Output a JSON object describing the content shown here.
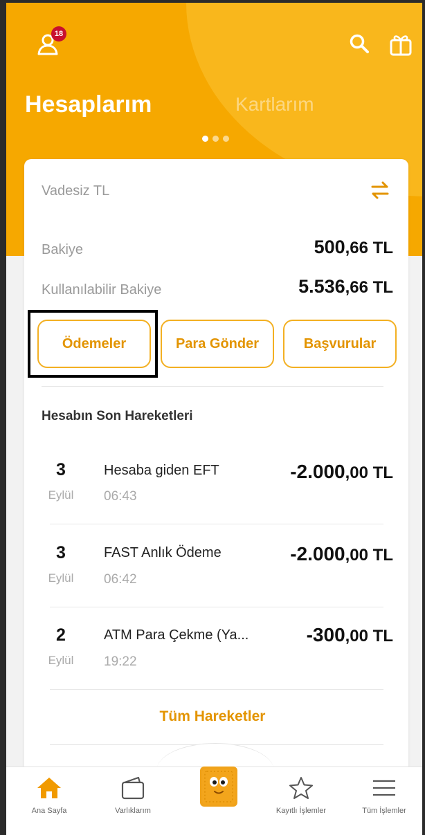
{
  "header": {
    "notification_count": "18",
    "tabs": [
      {
        "label": "Hesaplarım",
        "active": true
      },
      {
        "label": "Kartlarım",
        "active": false
      }
    ]
  },
  "account": {
    "name": "Vadesiz TL",
    "balance_label": "Bakiye",
    "balance_int": "500",
    "balance_dec": ",66 TL",
    "available_label": "Kullanılabilir Bakiye",
    "available_int": "5.536",
    "available_dec": ",66 TL"
  },
  "actions": {
    "payments": "Ödemeler",
    "send_money": "Para Gönder",
    "applications": "Başvurular"
  },
  "transactions": {
    "title": "Hesabın Son Hareketleri",
    "items": [
      {
        "day": "3",
        "month": "Eylül",
        "desc": "Hesaba giden EFT",
        "time": "06:43",
        "amount_int": "-2.000",
        "amount_dec": ",00 TL"
      },
      {
        "day": "3",
        "month": "Eylül",
        "desc": "FAST Anlık Ödeme",
        "time": "06:42",
        "amount_int": "-2.000",
        "amount_dec": ",00 TL"
      },
      {
        "day": "2",
        "month": "Eylül",
        "desc": "ATM Para Çekme (Ya...",
        "time": "19:22",
        "amount_int": "-300",
        "amount_dec": ",00 TL"
      }
    ],
    "all_link": "Tüm Hareketler"
  },
  "bottom_nav": {
    "items": [
      {
        "label": "Ana Sayfa",
        "icon": "home-icon"
      },
      {
        "label": "Varlıklarım",
        "icon": "wallet-icon"
      },
      {
        "label": "Kayıtlı İşlemler",
        "icon": "star-icon"
      },
      {
        "label": "Tüm İşlemler",
        "icon": "menu-icon"
      }
    ]
  },
  "colors": {
    "brand": "#f6a800",
    "accent_text": "#e39400"
  }
}
